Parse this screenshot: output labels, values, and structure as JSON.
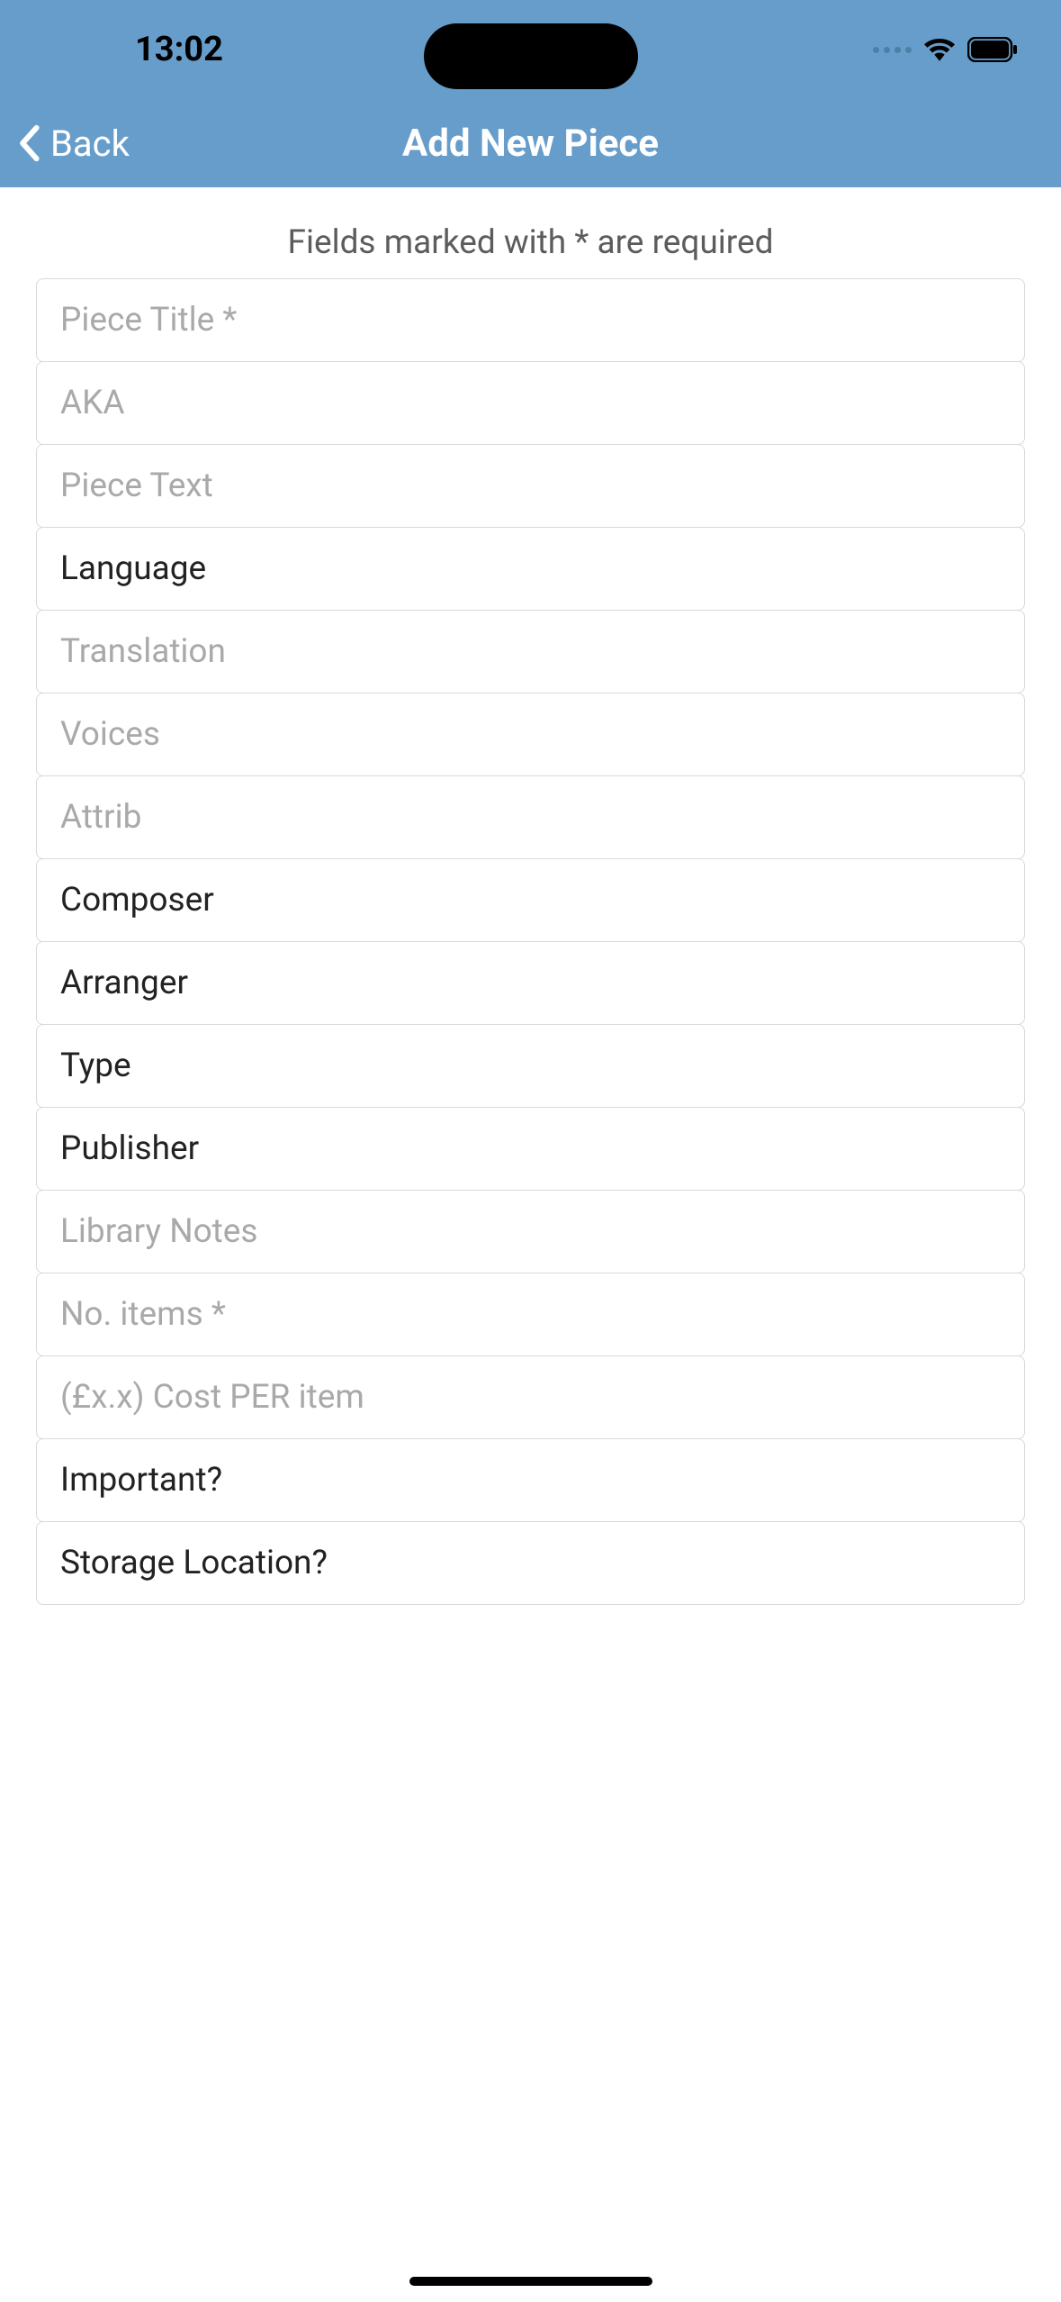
{
  "status": {
    "time": "13:02"
  },
  "nav": {
    "back_label": "Back",
    "title": "Add New Piece"
  },
  "form": {
    "required_hint": "Fields marked with * are required",
    "fields": {
      "piece_title": {
        "placeholder": "Piece Title *"
      },
      "aka": {
        "placeholder": "AKA"
      },
      "piece_text": {
        "placeholder": "Piece Text"
      },
      "language": {
        "label": "Language"
      },
      "translation": {
        "placeholder": "Translation"
      },
      "voices": {
        "placeholder": "Voices"
      },
      "attrib": {
        "placeholder": "Attrib"
      },
      "composer": {
        "label": "Composer"
      },
      "arranger": {
        "label": "Arranger"
      },
      "type": {
        "label": "Type"
      },
      "publisher": {
        "label": "Publisher"
      },
      "library_notes": {
        "placeholder": "Library Notes"
      },
      "no_items": {
        "placeholder": "No. items *"
      },
      "cost_per_item": {
        "placeholder": "(£x.x) Cost PER item"
      },
      "important": {
        "label": "Important?"
      },
      "storage_location": {
        "label": "Storage Location?"
      }
    }
  }
}
